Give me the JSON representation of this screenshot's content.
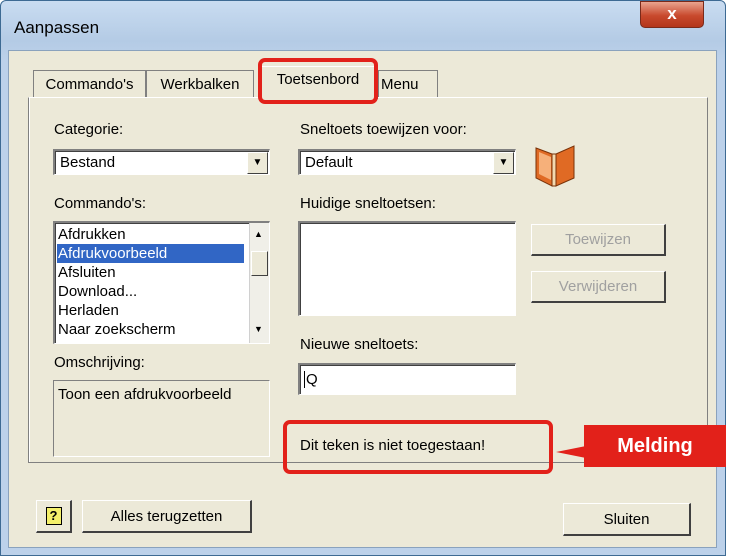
{
  "window": {
    "title": "Aanpassen",
    "close_glyph": "x"
  },
  "tabs": [
    {
      "label": "Commando's"
    },
    {
      "label": "Werkbalken"
    },
    {
      "label": "Toetsenbord"
    },
    {
      "label": "Menu"
    }
  ],
  "category": {
    "label": "Categorie:",
    "value": "Bestand"
  },
  "shortcut_for": {
    "label": "Sneltoets toewijzen voor:",
    "value": "Default"
  },
  "commands": {
    "label": "Commando's:",
    "items": [
      "Afdrukken",
      "Afdrukvoorbeeld",
      "Afsluiten",
      "Download...",
      "Herladen",
      "Naar zoekscherm"
    ],
    "selected": "Afdrukvoorbeeld"
  },
  "current_shortcuts": {
    "label": "Huidige sneltoetsen:"
  },
  "buttons": {
    "assign": "Toewijzen",
    "remove": "Verwijderen",
    "reset_all": "Alles terugzetten",
    "close": "Sluiten"
  },
  "description": {
    "label": "Omschrijving:",
    "text": "Toon een afdrukvoorbeeld"
  },
  "new_shortcut": {
    "label": "Nieuwe sneltoets:",
    "value": "Q"
  },
  "message": {
    "text": "Dit teken is niet toegestaan!"
  },
  "callout": {
    "label": "Melding"
  },
  "help_glyph": "?",
  "colors": {
    "highlight": "#e2211a",
    "selection": "#3166c5"
  }
}
